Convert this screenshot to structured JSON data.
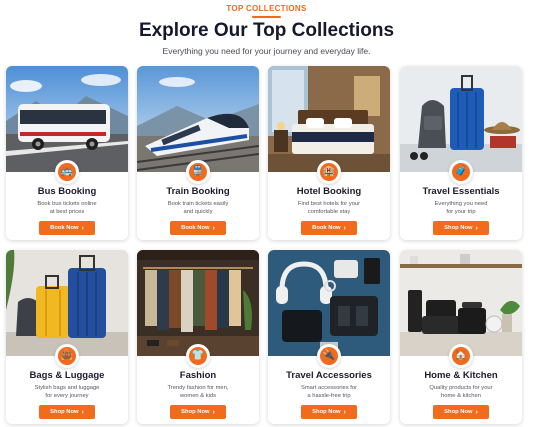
{
  "header": {
    "eyebrow": "TOP COLLECTIONS",
    "title": "Explore Our Top Collections",
    "subtitle": "Everything you need for your journey and everyday life."
  },
  "collections": [
    {
      "name": "Bus Booking",
      "desc1": "Book bus tickets online",
      "desc2": "at best prices",
      "button": "Book Now",
      "icon": "bus-icon"
    },
    {
      "name": "Train Booking",
      "desc1": "Book train tickets easily",
      "desc2": "and quickly",
      "button": "Book Now",
      "icon": "train-icon"
    },
    {
      "name": "Hotel Booking",
      "desc1": "Find best hotels for your",
      "desc2": "comfortable stay",
      "button": "Book Now",
      "icon": "hotel-icon"
    },
    {
      "name": "Travel Essentials",
      "desc1": "Everything you need",
      "desc2": "for your trip",
      "button": "Shop Now",
      "icon": "suitcase-icon"
    },
    {
      "name": "Bags & Luggage",
      "desc1": "Stylish bags and luggage",
      "desc2": "for every journey",
      "button": "Shop Now",
      "icon": "bag-icon"
    },
    {
      "name": "Fashion",
      "desc1": "Trendy fashion for men,",
      "desc2": "women & kids",
      "button": "Shop Now",
      "icon": "shirt-icon"
    },
    {
      "name": "Travel Accessories",
      "desc1": "Smart accessories for",
      "desc2": "a hassle-free trip",
      "button": "Shop Now",
      "icon": "plug-icon"
    },
    {
      "name": "Home & Kitchen",
      "desc1": "Quality products for your",
      "desc2": "home & kitchen",
      "button": "Shop Now",
      "icon": "home-icon"
    }
  ],
  "colors": {
    "accent": "#f26a1b",
    "title": "#17182d",
    "text": "#55555f"
  }
}
